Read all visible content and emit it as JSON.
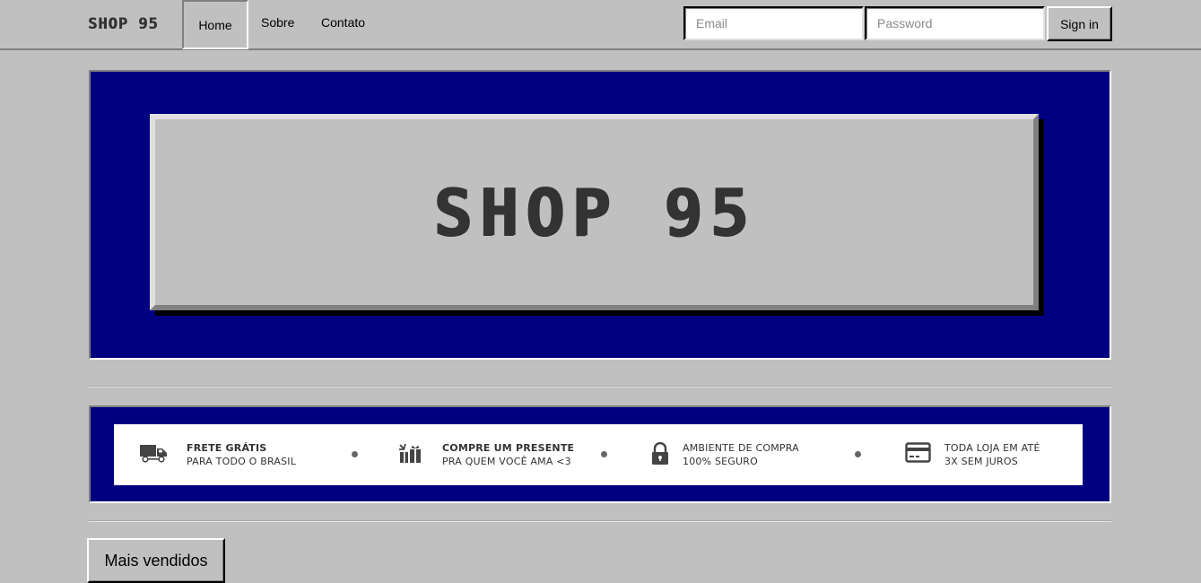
{
  "navbar": {
    "brand": "SHOP 95",
    "links": [
      {
        "label": "Home",
        "active": true
      },
      {
        "label": "Sobre",
        "active": false
      },
      {
        "label": "Contato",
        "active": false
      }
    ],
    "email_placeholder": "Email",
    "email_value": "",
    "password_placeholder": "Password",
    "password_value": "",
    "signin_label": "Sign in"
  },
  "hero": {
    "title": "SHOP 95"
  },
  "benefits": [
    {
      "icon": "truck-icon",
      "title": "FRETE GRÁTIS",
      "subtitle": "PARA TODO O BRASIL"
    },
    {
      "icon": "gift-icon",
      "title": "COMPRE UM PRESENTE",
      "subtitle": "PRA QUEM VOCÊ AMA <3"
    },
    {
      "icon": "lock-icon",
      "title": "AMBIENTE DE COMPRA",
      "subtitle": "100% SEGURO"
    },
    {
      "icon": "credit-card-icon",
      "title": "TODA LOJA EM ATÉ",
      "subtitle": "3X SEM JUROS"
    }
  ],
  "section": {
    "label": "Mais vendidos"
  },
  "colors": {
    "background": "#c0c0c0",
    "navy": "#000080",
    "text_dark": "#333333"
  }
}
